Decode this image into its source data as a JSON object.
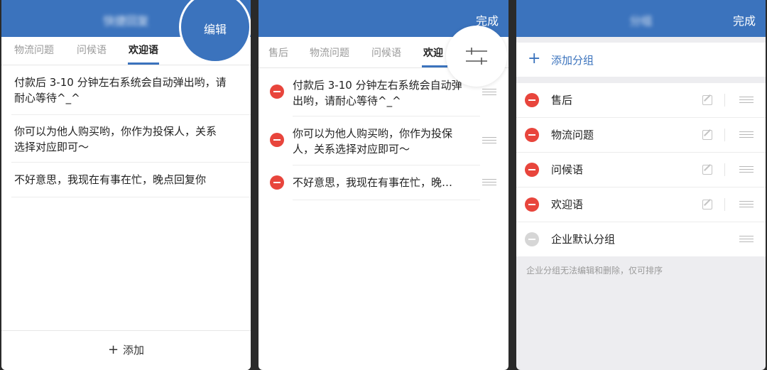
{
  "panel1": {
    "title": "快捷回复",
    "edit_label": "编辑",
    "tabs": [
      {
        "label": "物流问题",
        "active": false
      },
      {
        "label": "问候语",
        "active": false
      },
      {
        "label": "欢迎语",
        "active": true
      }
    ],
    "items": [
      {
        "line1": "付款后 3-10 分钟左右系统会自动弹出哟，请",
        "line2": "耐心等待^_^"
      },
      {
        "line1": "你可以为他人购买哟，你作为投保人，关系",
        "line2": "选择对应即可～"
      },
      {
        "line1": "不好意思，我现在有事在忙，晚点回复你",
        "line2": ""
      }
    ],
    "add_label": "添加",
    "add_icon": "plus-icon"
  },
  "panel2": {
    "done_label": "完成",
    "tabs": [
      {
        "label": "售后",
        "active": false
      },
      {
        "label": "物流问题",
        "active": false
      },
      {
        "label": "问候语",
        "active": false
      },
      {
        "label": "欢迎",
        "active": true
      }
    ],
    "sort_icon": "sort-sliders-icon",
    "items": [
      {
        "line1": "付款后 3-10 分钟左右系统会自动弹",
        "line2": "出哟，请耐心等待^_^"
      },
      {
        "line1": "你可以为他人购买哟，你作为投保",
        "line2": "人，关系选择对应即可～"
      },
      {
        "line1": "不好意思，我现在有事在忙，晚…",
        "line2": ""
      }
    ]
  },
  "panel3": {
    "title": "分组",
    "done_label": "完成",
    "add_group_label": "添加分组",
    "groups": [
      {
        "label": "售后",
        "editable": true
      },
      {
        "label": "物流问题",
        "editable": true
      },
      {
        "label": "问候语",
        "editable": true
      },
      {
        "label": "欢迎语",
        "editable": true
      },
      {
        "label": "企业默认分组",
        "editable": false
      }
    ],
    "footnote": "企业分组无法编辑和删除，仅可排序"
  },
  "colors": {
    "brand_blue": "#3b73bd",
    "delete_red": "#e8453c",
    "disabled_gray": "#d6d6d6"
  }
}
